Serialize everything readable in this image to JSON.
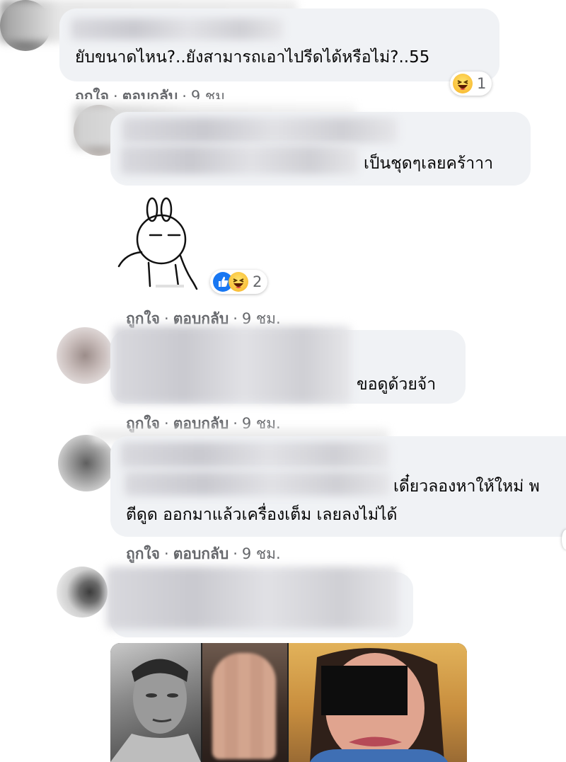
{
  "comments": [
    {
      "text": "ยับขนาดไหน?..ยังสามารถเอาไปรีดได้หรือไม่?..55",
      "reaction_count": "1",
      "actions": {
        "like": "ถูกใจ",
        "reply": "ตอบกลับ",
        "time": "9 ชม."
      }
    },
    {
      "text": "เป็นชุดๆเลยคร้าาา",
      "reaction_count": "2",
      "actions": {
        "like": "ถูกใจ",
        "reply": "ตอบกลับ",
        "time": "9 ชม."
      }
    },
    {
      "text": "ขอดูด้วยจ้า",
      "actions": {
        "like": "ถูกใจ",
        "reply": "ตอบกลับ",
        "time": "9 ชม."
      }
    },
    {
      "line1": "เดี๋ยวลองหาให้ใหม่ พ",
      "line2": "ตีดูด ออกมาแล้วเครื่องเต็ม เลยลงไม่ได้",
      "actions": {
        "like": "ถูกใจ",
        "reply": "ตอบกลับ",
        "time": "9 ชม."
      }
    }
  ],
  "separator": "·",
  "colors": {
    "bubble": "#f0f2f5",
    "meta_text": "#65676b",
    "like_blue": "#1877f2",
    "haha_yellow": "#f7b125"
  },
  "icons": [
    "haha-reaction-icon",
    "like-reaction-icon",
    "sticker-bunny"
  ]
}
